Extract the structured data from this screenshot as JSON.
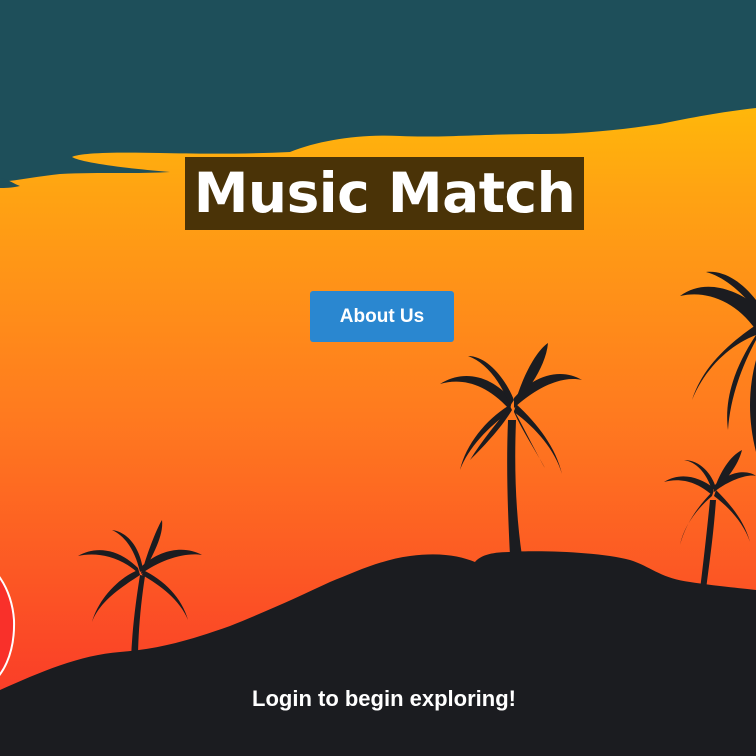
{
  "app": {
    "title": "Music Match"
  },
  "nav": {
    "about_label": "About Us"
  },
  "footer": {
    "login_prompt": "Login to begin exploring!"
  },
  "theme": {
    "sky_top": "#1e4f5a",
    "sunset_yellow": "#ffc107",
    "sunset_orange": "#ff8a1a",
    "sunset_red": "#f9302a",
    "silhouette": "#1b1c20",
    "title_box": "#4a3307",
    "button_blue": "#2a87d0"
  },
  "icons": [
    "palm-tree-icon",
    "guitar-icon"
  ]
}
